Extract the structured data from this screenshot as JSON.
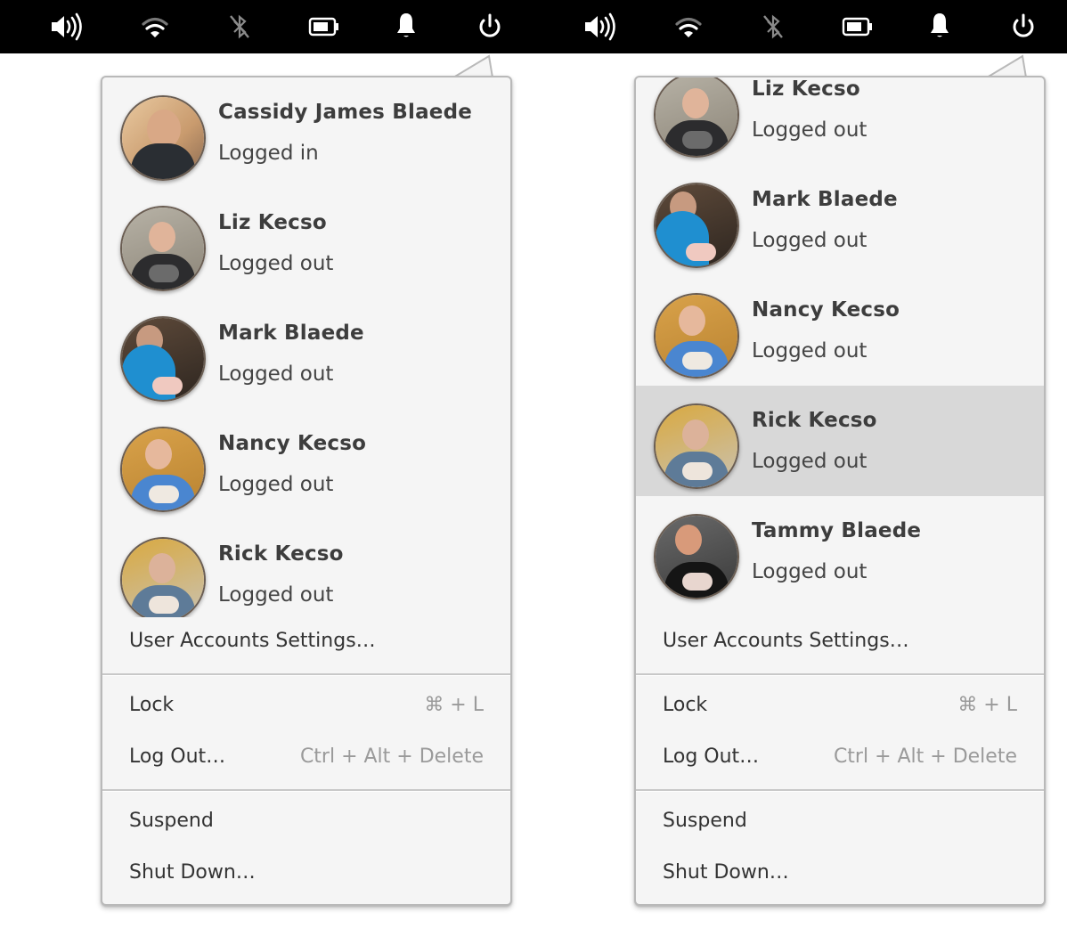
{
  "panels": [
    {
      "indicators": [
        {
          "name": "volume-icon",
          "state": "on"
        },
        {
          "name": "wifi-icon",
          "state": "on"
        },
        {
          "name": "bluetooth-disabled-icon",
          "state": "off"
        },
        {
          "name": "battery-icon",
          "state": "charged"
        },
        {
          "name": "notifications-bell-icon",
          "state": "on"
        },
        {
          "name": "power-icon",
          "state": "active"
        }
      ],
      "users": [
        {
          "name": "Cassidy James Blaede",
          "status": "Logged in",
          "highlighted": false
        },
        {
          "name": "Liz Kecso",
          "status": "Logged out",
          "highlighted": false
        },
        {
          "name": "Mark Blaede",
          "status": "Logged out",
          "highlighted": false
        },
        {
          "name": "Nancy Kecso",
          "status": "Logged out",
          "highlighted": false
        },
        {
          "name": "Rick Kecso",
          "status": "Logged out",
          "highlighted": false
        }
      ],
      "settings_label": "User Accounts Settings…",
      "lock": {
        "label": "Lock",
        "accel": "⌘ + L"
      },
      "logout": {
        "label": "Log Out…",
        "accel": "Ctrl + Alt + Delete"
      },
      "suspend": {
        "label": "Suspend"
      },
      "shutdown": {
        "label": "Shut Down…"
      }
    },
    {
      "indicators": [
        {
          "name": "volume-icon",
          "state": "on"
        },
        {
          "name": "wifi-icon",
          "state": "on"
        },
        {
          "name": "bluetooth-disabled-icon",
          "state": "off"
        },
        {
          "name": "battery-icon",
          "state": "charged"
        },
        {
          "name": "notifications-bell-icon",
          "state": "on"
        },
        {
          "name": "power-icon",
          "state": "active"
        }
      ],
      "users": [
        {
          "name": "Liz Kecso",
          "status": "Logged out",
          "highlighted": false
        },
        {
          "name": "Mark Blaede",
          "status": "Logged out",
          "highlighted": false
        },
        {
          "name": "Nancy Kecso",
          "status": "Logged out",
          "highlighted": false
        },
        {
          "name": "Rick Kecso",
          "status": "Logged out",
          "highlighted": true
        },
        {
          "name": "Tammy Blaede",
          "status": "Logged out",
          "highlighted": false
        }
      ],
      "settings_label": "User Accounts Settings…",
      "lock": {
        "label": "Lock",
        "accel": "⌘ + L"
      },
      "logout": {
        "label": "Log Out…",
        "accel": "Ctrl + Alt + Delete"
      },
      "suspend": {
        "label": "Suspend"
      },
      "shutdown": {
        "label": "Shut Down…"
      }
    }
  ],
  "colors": {
    "panel_bg": "#000000",
    "popover_bg": "#f5f5f5",
    "highlight_bg": "#d8d8d8",
    "text": "#333333",
    "accel_text": "#9a9a9a"
  }
}
